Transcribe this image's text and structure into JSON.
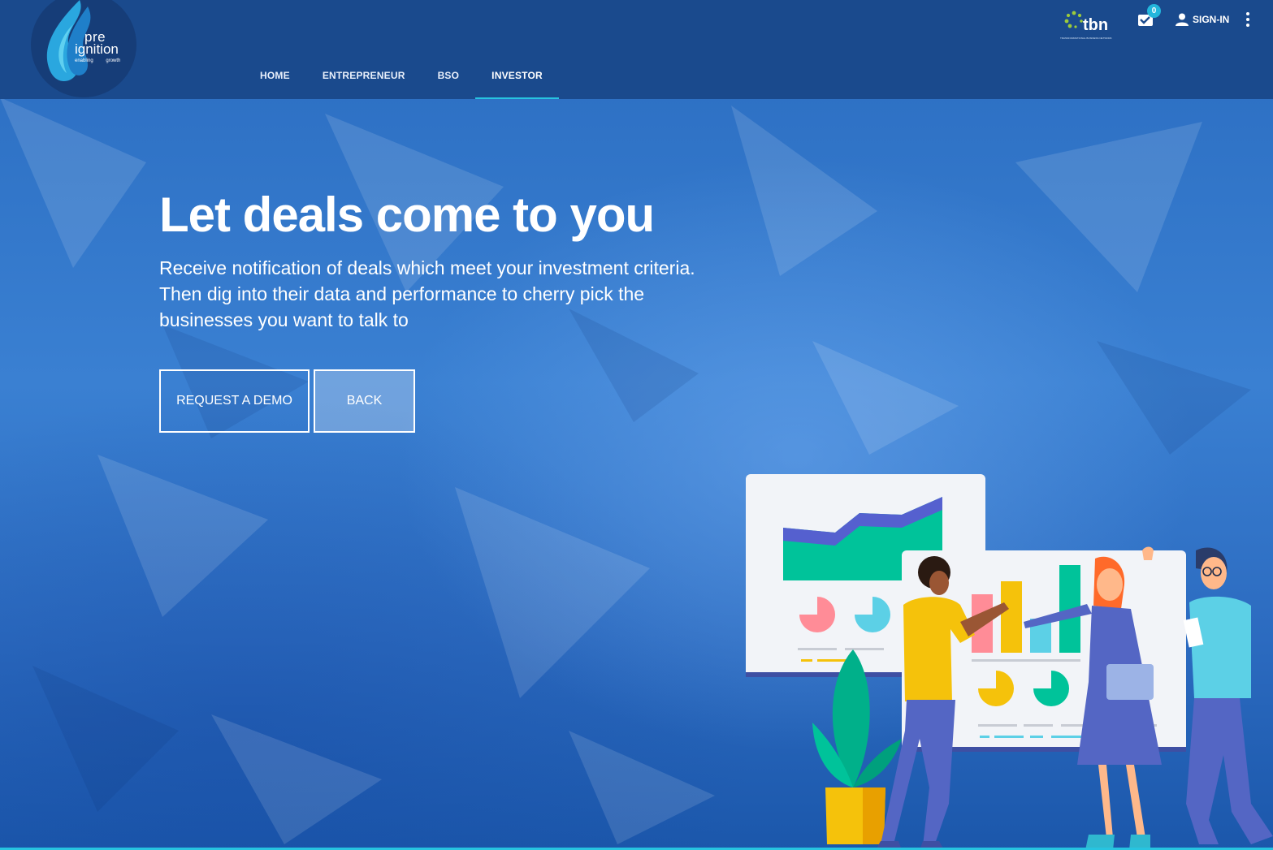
{
  "header": {
    "logo": {
      "word_top": "pre",
      "word_main": "ignition",
      "tagline": "enabling growth"
    },
    "nav": [
      {
        "label": "HOME",
        "active": false
      },
      {
        "label": "ENTREPRENEUR",
        "active": false
      },
      {
        "label": "BSO",
        "active": false
      },
      {
        "label": "INVESTOR",
        "active": true
      }
    ],
    "partner_logo": {
      "word": "tbn",
      "subtitle": "TRANSFORMATIONAL BUSINESS NETWORK"
    },
    "notifications": {
      "icon": "mail-check-icon",
      "count": "0"
    },
    "signin": {
      "icon": "person-icon",
      "label": "SIGN-IN"
    },
    "menu": {
      "icon": "more-vertical-icon"
    }
  },
  "hero": {
    "title": "Let deals come to you",
    "text": "Receive notification of deals which meet your investment criteria. Then dig into their data and performance to cherry pick the businesses you want to talk to",
    "buttons": {
      "demo": "REQUEST A DEMO",
      "back": "BACK"
    }
  },
  "colors": {
    "header_bg": "#1a4a8d",
    "accent": "#27c4e0",
    "hero_bg": "#2f74c8"
  }
}
